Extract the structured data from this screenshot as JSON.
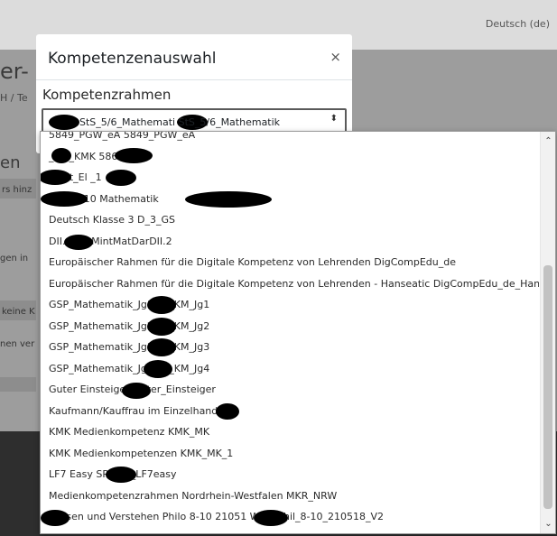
{
  "header": {
    "language": "Deutsch (de)"
  },
  "background": {
    "title_fragment": "er- u",
    "breadcrumb_fragment": "H / Te",
    "heading_fragment": "en",
    "fragment_1": "rs hinz",
    "fragment_2": "gen in",
    "fragment_3": "keine K",
    "fragment_4": "nen ver"
  },
  "modal": {
    "title": "Kompetenzenauswahl",
    "close_symbol": "×",
    "field_label": "Kompetenzrahmen",
    "select_value": "StS_5/6_Mathemati       StS_5/6_Mathematik",
    "select_arrows": "⬍"
  },
  "dropdown": {
    "options": [
      "5849_PGW_eA 5849_PGW_eA",
      "        _hlg_KMK              586401",
      "         _Test_El          _1",
      "                 Klasse 10 Mathematik",
      "Deutsch Klasse 3 D_3_GS",
      "DII.           WissMintMatDarDII.2",
      "Europäischer Rahmen für die Digitale Kompetenz von Lehrenden DigCompEdu_de",
      "Europäischer Rahmen für die Digitale Kompetenz von Lehrenden - Hanseatic DigCompEdu_de_Hanseatic",
      "GSP_Mathematik_Jg1          gp_KM_Jg1",
      "GSP_Mathematik_Jg2          gp_KM_Jg2",
      "GSP_Mathematik_Jg3          gp_KM_Jg3",
      "GSP_Mathematik_Jg4          gp_KM_Jg4",
      "Guter Einsteiger          Guter_Einsteiger",
      "Kaufmann/Kauffrau im Einzelhandel",
      "KMK Medienkompetenz KMK_MK",
      "KMK Medienkompetenzen KMK_MK_1",
      "LF7 Easy SPS          BS_LF7easy",
      "Medienkompetenzrahmen Nordrhein-Westfalen MKR_NRW",
      "         Wissen und Verstehen Philo 8-10 21051          Wiss_Phil_8-10_210518_V2"
    ],
    "scroll_up": "⌃",
    "scroll_down": "⌄"
  }
}
